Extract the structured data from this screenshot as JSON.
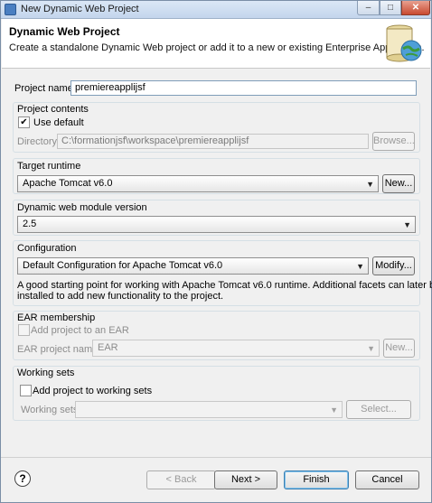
{
  "window": {
    "title": "New Dynamic Web Project",
    "min": "–",
    "max": "□",
    "close": "✕"
  },
  "header": {
    "title": "Dynamic Web Project",
    "description": "Create a standalone Dynamic Web project or add it to a new or existing Enterprise Application."
  },
  "project_name": {
    "label": "Project name:",
    "value": "premiereapplijsf"
  },
  "project_contents": {
    "title": "Project contents",
    "use_default_label": "Use default",
    "use_default_checked": true,
    "directory_label": "Directory:",
    "directory_value": "C:\\formationjsf\\workspace\\premiereapplijsf",
    "browse_label": "Browse..."
  },
  "target_runtime": {
    "title": "Target runtime",
    "value": "Apache Tomcat v6.0",
    "new_label": "New..."
  },
  "module_version": {
    "title": "Dynamic web module version",
    "value": "2.5"
  },
  "configuration": {
    "title": "Configuration",
    "value": "Default Configuration for Apache Tomcat v6.0",
    "modify_label": "Modify...",
    "desc_line1": "A good starting point for working with Apache Tomcat v6.0 runtime. Additional facets can later be",
    "desc_line2": "installed to add new functionality to the project."
  },
  "ear": {
    "title": "EAR membership",
    "add_label": "Add project to an EAR",
    "project_name_label": "EAR project name:",
    "project_name_value": "EAR",
    "new_label": "New..."
  },
  "working_sets": {
    "title": "Working sets",
    "add_label": "Add project to working sets",
    "sets_label": "Working sets:",
    "sets_value": "",
    "select_label": "Select..."
  },
  "footer": {
    "help": "?",
    "back_label": "< Back",
    "next_label": "Next >",
    "finish_label": "Finish",
    "cancel_label": "Cancel"
  }
}
